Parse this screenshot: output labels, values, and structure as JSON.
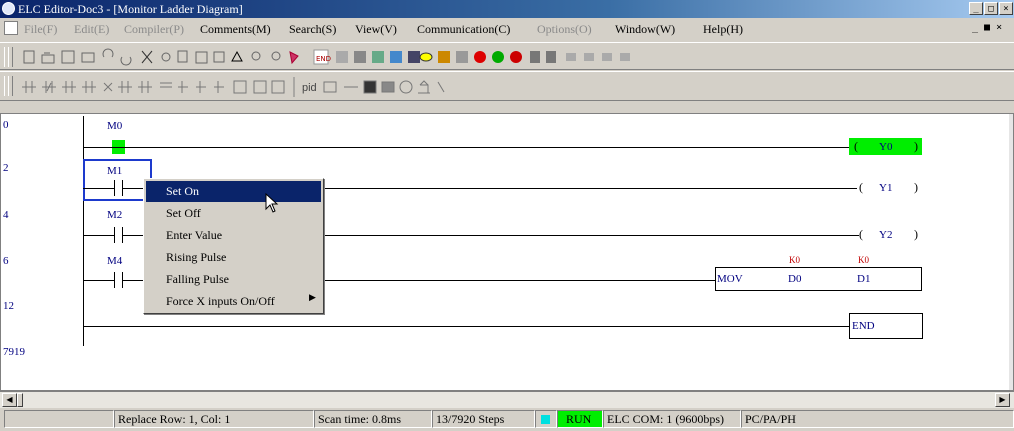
{
  "window": {
    "title": "ELC Editor-Doc3 - [Monitor Ladder Diagram]",
    "buttons": [
      "_",
      "□",
      "×"
    ]
  },
  "menu": [
    {
      "label": "File(F)",
      "enabled": false
    },
    {
      "label": "Edit(E)",
      "enabled": false
    },
    {
      "label": "Compiler(P)",
      "enabled": false
    },
    {
      "label": "Comments(M)",
      "enabled": true
    },
    {
      "label": "Search(S)",
      "enabled": true
    },
    {
      "label": "View(V)",
      "enabled": true
    },
    {
      "label": "Communication(C)",
      "enabled": true
    },
    {
      "label": "Options(O)",
      "enabled": false
    },
    {
      "label": "Window(W)",
      "enabled": true
    },
    {
      "label": "Help(H)",
      "enabled": true
    }
  ],
  "toolbar2_text": "pid",
  "ladder": {
    "steps": [
      "0",
      "2",
      "4",
      "6",
      "12",
      "7919"
    ],
    "contacts": [
      "M0",
      "M1",
      "M2",
      "M4"
    ],
    "coils": [
      "Y0",
      "Y1",
      "Y2"
    ],
    "mov": {
      "op": "MOV",
      "src": "D0",
      "dst": "D1",
      "src_k": "K0",
      "dst_k": "K0"
    },
    "end": "END"
  },
  "context_menu": [
    {
      "label": "Set On",
      "selected": true
    },
    {
      "label": "Set Off",
      "selected": false
    },
    {
      "label": "Enter Value",
      "selected": false
    },
    {
      "label": "Rising Pulse",
      "selected": false
    },
    {
      "label": "Falling Pulse",
      "selected": false
    },
    {
      "label": "Force X inputs On/Off",
      "selected": false,
      "submenu": true
    }
  ],
  "status": {
    "mode": "Replace",
    "position": "Row: 1, Col: 1",
    "scan_time": "Scan time: 0.8ms",
    "steps": "13/7920 Steps",
    "run": "RUN",
    "com": "ELC COM: 1  (9600bps)",
    "model": "PC/PA/PH"
  },
  "colors": {
    "active_green": "#00ee00",
    "ladder_text": "#000080",
    "highlight": "#0a246a"
  }
}
